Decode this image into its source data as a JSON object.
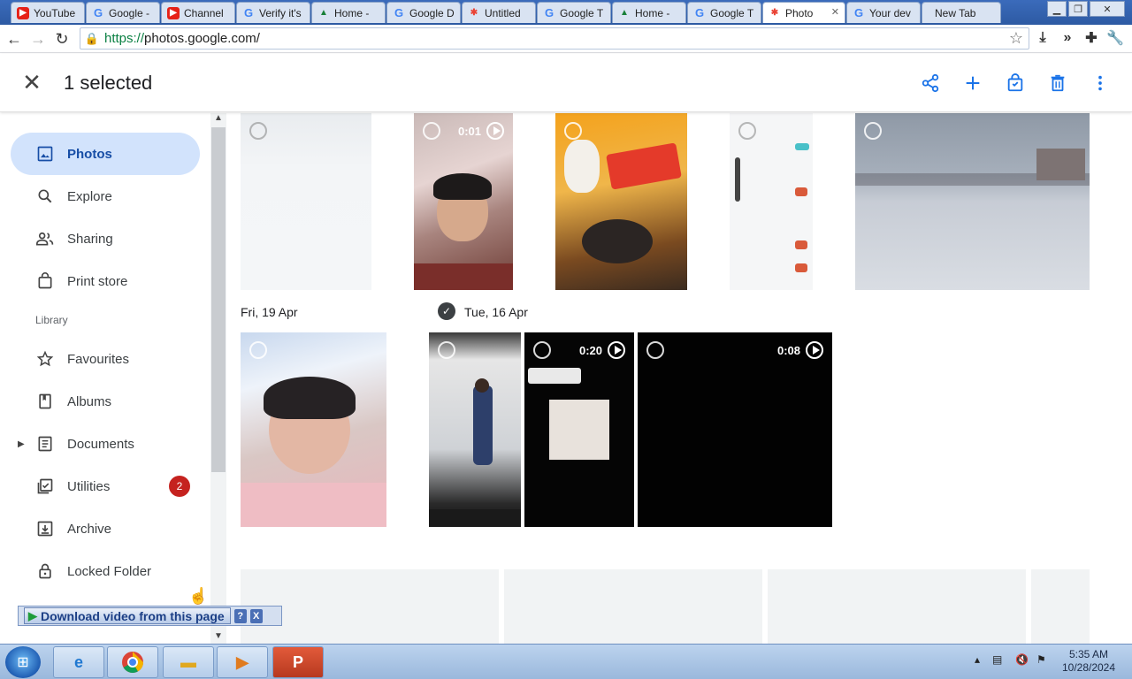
{
  "browser": {
    "tabs": [
      {
        "label": "YouTube",
        "favicon": "youtube-icon"
      },
      {
        "label": "Google -",
        "favicon": "google-icon"
      },
      {
        "label": "Channel",
        "favicon": "youtube-icon"
      },
      {
        "label": "Verify it's",
        "favicon": "google-icon"
      },
      {
        "label": "Home -",
        "favicon": "drive-icon"
      },
      {
        "label": "Google D",
        "favicon": "google-icon"
      },
      {
        "label": "Untitled",
        "favicon": "photos-icon"
      },
      {
        "label": "Google T",
        "favicon": "google-icon"
      },
      {
        "label": "Home -",
        "favicon": "drive-icon"
      },
      {
        "label": "Google T",
        "favicon": "google-icon"
      },
      {
        "label": "Photo",
        "favicon": "photos-icon",
        "active": true
      },
      {
        "label": "Your dev",
        "favicon": "google-icon"
      },
      {
        "label": "New Tab",
        "favicon": ""
      }
    ],
    "url_scheme": "https://",
    "url_rest": "photos.google.com/"
  },
  "header": {
    "selection_text": "1 selected",
    "accent_color": "#1a73e8",
    "actions": [
      "share-icon",
      "add-icon",
      "print-store-icon",
      "delete-icon",
      "more-vert-icon"
    ]
  },
  "sidebar": {
    "items": [
      {
        "label": "Photos",
        "icon": "photo-icon",
        "active": true
      },
      {
        "label": "Explore",
        "icon": "search-icon"
      },
      {
        "label": "Sharing",
        "icon": "people-icon"
      },
      {
        "label": "Print store",
        "icon": "shopping-bag-icon"
      }
    ],
    "library_heading": "Library",
    "library_items": [
      {
        "label": "Favourites",
        "icon": "star-icon"
      },
      {
        "label": "Albums",
        "icon": "album-icon"
      },
      {
        "label": "Documents",
        "icon": "document-icon",
        "expandable": true
      },
      {
        "label": "Utilities",
        "icon": "utilities-icon",
        "badge": "2"
      },
      {
        "label": "Archive",
        "icon": "archive-icon"
      },
      {
        "label": "Locked Folder",
        "icon": "lock-icon"
      }
    ]
  },
  "content": {
    "dates": [
      "Fri, 19 Apr",
      "Tue, 16 Apr"
    ],
    "durations": [
      "0:01",
      "0:20",
      "0:08"
    ]
  },
  "download_bar": {
    "label": "Download video from this page",
    "help": "?",
    "close": "X"
  },
  "taskbar": {
    "time": "5:35 AM",
    "date": "10/28/2024"
  }
}
